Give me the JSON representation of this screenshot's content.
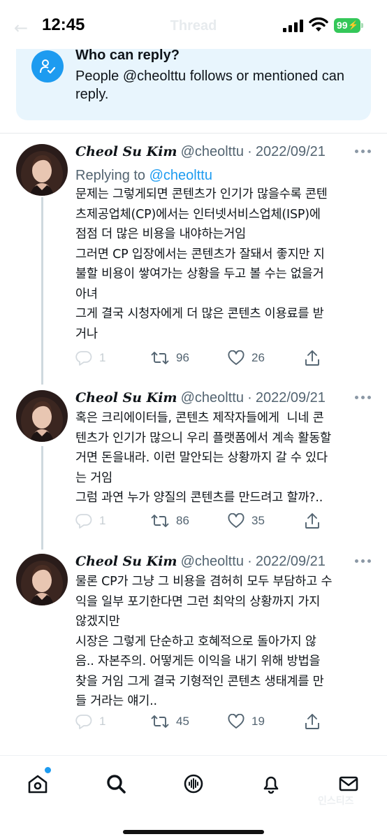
{
  "status_bar": {
    "time": "12:45",
    "battery": "99",
    "nav_title": "Thread",
    "back_glyph": "←"
  },
  "reply_banner": {
    "title": "Who can reply?",
    "text": "People @cheolttu follows or mentioned can reply.",
    "icon": "person-check-icon"
  },
  "tweets": [
    {
      "name": "Cheol Su Kim",
      "handle": "@cheolttu",
      "separator": "·",
      "date": "2022/09/21",
      "replying_prefix": "Replying to ",
      "replying_to": "@cheolttu",
      "body": "문제는 그렇게되면 콘텐츠가 인기가 많을수록 콘텐\n츠제공업체(CP)에서는 인터넷서비스업체(ISP)에\n점점 더 많은 비용을 내야하는거임\n그러면 CP 입장에서는 콘텐츠가 잘돼서 좋지만 지\n불할 비용이 쌓여가는 상황을 두고 볼 수는 없을거\n아녀\n그게 결국 시청자에게 더 많은 콘텐츠 이용료를 받\n거나",
      "replies": "1",
      "retweets": "96",
      "likes": "26"
    },
    {
      "name": "Cheol Su Kim",
      "handle": "@cheolttu",
      "separator": "·",
      "date": "2022/09/21",
      "body": "혹은 크리에이터들, 콘텐츠 제작자들에게  니네 콘\n텐츠가 인기가 많으니 우리 플랫폼에서 계속 활동할\n거면 돈을내라. 이런 말안되는 상황까지 갈 수 있다\n는 거임\n그럼 과연 누가 양질의 콘텐츠를 만드려고 할까?..",
      "replies": "1",
      "retweets": "86",
      "likes": "35"
    },
    {
      "name": "Cheol Su Kim",
      "handle": "@cheolttu",
      "separator": "·",
      "date": "2022/09/21",
      "body": "물론 CP가 그냥 그 비용을 겸허히 모두 부담하고 수\n익을 일부 포기한다면 그런 최악의 상황까지 가지\n않겠지만\n시장은 그렇게 단순하고 호혜적으로 돌아가지 않\n음.. 자본주의. 어떻게든 이익을 내기 위해 방법을\n찾을 거임 그게 결국 기형적인 콘텐츠 생태계를 만\n들 거라는 얘기..",
      "replies": "1",
      "retweets": "45",
      "likes": "19"
    }
  ],
  "bottom_nav": {
    "items": [
      "home-icon",
      "search-icon",
      "spaces-icon",
      "notifications-icon",
      "messages-icon"
    ]
  },
  "watermark": "인스티즈",
  "colors": {
    "accent": "#1d9bf0",
    "banner_bg": "#e8f5fd",
    "muted": "#536471",
    "battery": "#34c759"
  }
}
